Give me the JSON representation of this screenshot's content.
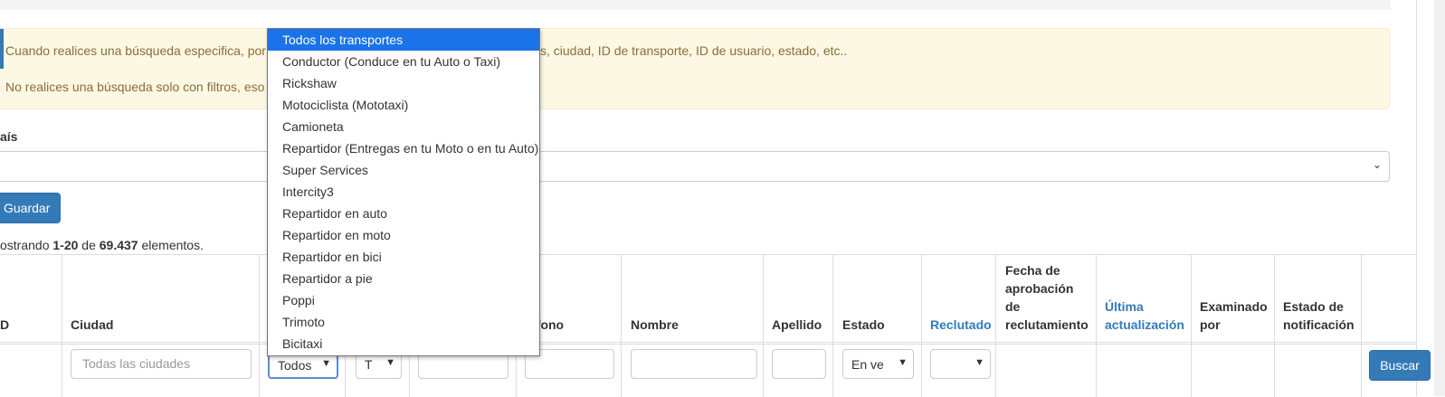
{
  "alert": {
    "line1_start": "Cuando realices una búsqueda especifica, por",
    "line1_end": "s, ciudad, ID de transporte, ID de usuario, estado, etc..",
    "line2_start": "No realices una búsqueda solo con filtros, eso"
  },
  "country": {
    "label": "aís"
  },
  "buttons": {
    "save": "Guardar",
    "search": "Buscar"
  },
  "summary": {
    "prefix": "ostrando",
    "range": "1-20",
    "middle": "de",
    "total": "69.437",
    "suffix": "elementos."
  },
  "table": {
    "headers": {
      "id": "D",
      "city": "Ciudad",
      "phone": "éfono",
      "first_name": "Nombre",
      "last_name": "Apellido",
      "status": "Estado",
      "recruited": "Reclutado",
      "recruit_approval": [
        "Fecha de",
        "aprobación",
        "de",
        "reclutamiento"
      ],
      "last_update": [
        "Última",
        "actualización"
      ],
      "reviewed_by": [
        "Examinado",
        "por"
      ],
      "notification_status": [
        "Estado de",
        "notificación"
      ]
    },
    "filters": {
      "city_placeholder": "Todas las ciudades",
      "transport_value": "Todos",
      "type_value": "T",
      "status_value": "En ve",
      "recruited_value": ""
    }
  },
  "transport_dropdown": {
    "selected_index": 0,
    "options": [
      "Todos los transportes",
      "Conductor (Conduce en tu Auto o Taxi)",
      "Rickshaw",
      "Motociclista (Mototaxi)",
      "Camioneta",
      "Repartidor (Entregas en tu Moto o en tu Auto)",
      "Super Services",
      "Intercity3",
      "Repartidor en auto",
      "Repartidor en moto",
      "Repartidor en bici",
      "Repartidor a pie",
      "Poppi",
      "Trimoto",
      "Bicitaxi"
    ]
  }
}
